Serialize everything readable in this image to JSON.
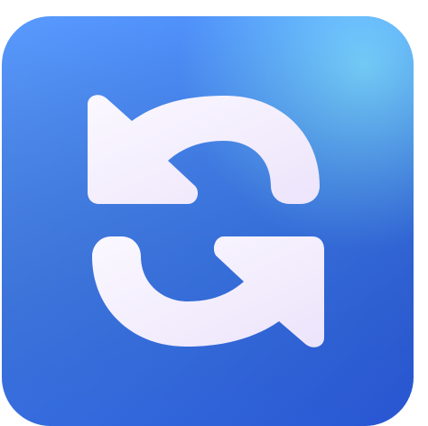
{
  "icon": {
    "name": "counterclockwise-arrows-icon",
    "tile_color": "#4d8fff",
    "tile_highlight": "#6fd0ff",
    "tile_shadow": "#2f5fe0",
    "glyph_color": "#f5efff"
  }
}
